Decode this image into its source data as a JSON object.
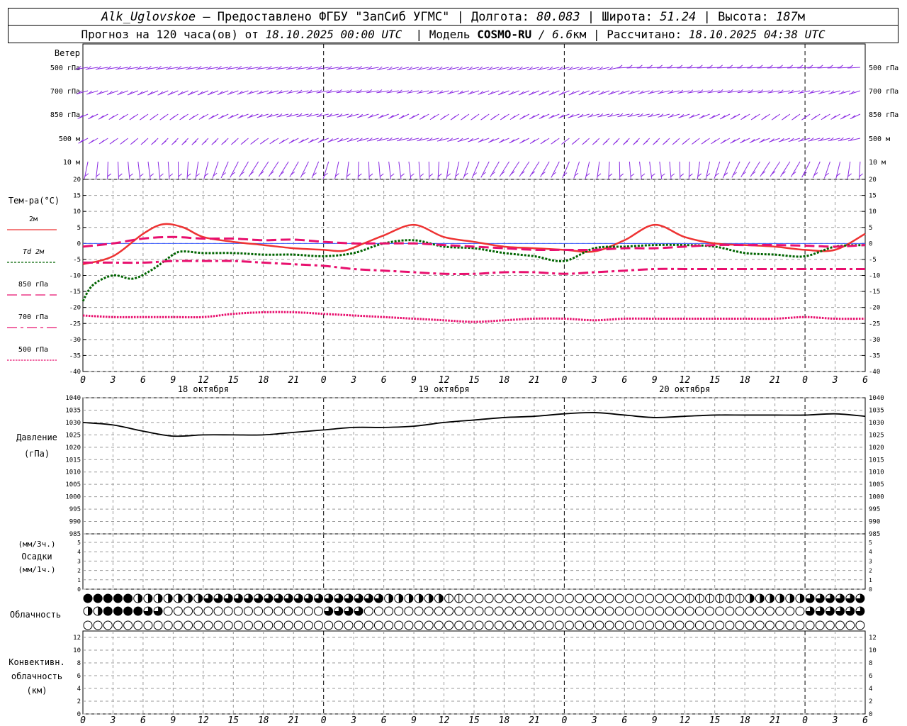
{
  "header": {
    "station": "Alk_Uglovskoe",
    "provider": "– Предоставлено ФГБУ \"ЗапСиб УГМС\"",
    "lon_label": "| Долгота:",
    "lon_value": "80.083",
    "lat_label": "| Широта:",
    "lat_value": "51.24",
    "alt_label": "| Высота:",
    "alt_value": "187",
    "alt_unit": "м",
    "forecast_label": "Прогноз на 120 часа(ов) от",
    "forecast_start": "18.10.2025 00:00 UTC",
    "model_label": "| Модель",
    "model_name": "COSMO-RU",
    "model_res_value": "/ 6.6",
    "model_res_unit": "км",
    "calc_label": "| Рассчитано:",
    "calc_time": "18.10.2025 04:38 UTC"
  },
  "colors": {
    "wind": "#8a2be2",
    "t2m": "#ee3333",
    "td2m": "#006400",
    "t850": "#e8106e",
    "t700": "#e8106e",
    "t500": "#e8106e",
    "pressure": "#000000",
    "grid": "#999999"
  },
  "chart_data": [
    {
      "type": "wind-barbs",
      "panel_label": "Ветер",
      "levels": [
        "500 гПа",
        "700 гПа",
        "850 гПа",
        "500 м",
        "10 м"
      ],
      "x_unit": "hours",
      "xlim": [
        0,
        78
      ]
    },
    {
      "type": "line",
      "panel_label": "Тем-ра(°C)",
      "ylim": [
        -40,
        20
      ],
      "yticks": [
        -40,
        -35,
        -30,
        -25,
        -20,
        -15,
        -10,
        -5,
        0,
        5,
        10,
        15,
        20
      ],
      "x_ticks": [
        "0",
        "3",
        "6",
        "9",
        "12",
        "15",
        "18",
        "21",
        "0",
        "3",
        "6",
        "9",
        "12",
        "15",
        "18",
        "21",
        "0",
        "3",
        "6",
        "9",
        "12",
        "15",
        "18",
        "21",
        "0",
        "3",
        "6"
      ],
      "dates": [
        "18 октября",
        "19 октября",
        "20 октября"
      ],
      "series": [
        {
          "name": "2м",
          "key": "t2m",
          "style": "solid",
          "x": [
            0,
            3,
            6,
            8,
            10,
            12,
            15,
            18,
            21,
            24,
            26,
            28,
            30,
            33,
            36,
            39,
            42,
            45,
            48,
            51,
            54,
            57,
            60,
            63,
            66,
            69,
            72,
            75,
            78
          ],
          "y": [
            -6.5,
            -4,
            3,
            6,
            5,
            2,
            0.5,
            -0.5,
            -1.5,
            -2,
            -2.3,
            0,
            2.5,
            5.8,
            2,
            0.5,
            -1,
            -1.5,
            -2,
            -2.5,
            1,
            5.8,
            2,
            0,
            -0.5,
            -1,
            -2,
            -2,
            3
          ]
        },
        {
          "name": "Td 2м",
          "key": "td2m",
          "style": "dotted",
          "x": [
            0,
            1,
            3,
            5,
            7,
            9,
            10,
            12,
            15,
            18,
            21,
            24,
            27,
            30,
            33,
            36,
            39,
            42,
            45,
            48,
            51,
            54,
            57,
            60,
            63,
            66,
            69,
            72,
            75,
            78
          ],
          "y": [
            -18,
            -13,
            -10,
            -11,
            -8,
            -3.5,
            -2.5,
            -3,
            -3,
            -3.5,
            -3.5,
            -4,
            -3,
            0,
            1,
            -1,
            -1.5,
            -3,
            -4,
            -5.5,
            -1.5,
            -1,
            -0.5,
            -0.5,
            -1,
            -3,
            -3.5,
            -4,
            -1,
            -0.5
          ]
        },
        {
          "name": "850 гПа",
          "key": "t850",
          "style": "dashed",
          "x": [
            0,
            3,
            6,
            9,
            12,
            15,
            18,
            21,
            24,
            27,
            30,
            33,
            36,
            39,
            42,
            45,
            48,
            51,
            54,
            57,
            60,
            63,
            66,
            69,
            72,
            75,
            78
          ],
          "y": [
            -1,
            0,
            1.5,
            2,
            1.5,
            1.5,
            1,
            1.2,
            0.5,
            0,
            0,
            0,
            -0.5,
            -1,
            -1.5,
            -2,
            -2,
            -2,
            -1.5,
            -1.5,
            -1,
            -0.5,
            -0.5,
            -0.5,
            -0.7,
            -1,
            -0.5
          ]
        },
        {
          "name": "700 гПа",
          "key": "t700",
          "style": "dashdot",
          "x": [
            0,
            3,
            6,
            9,
            12,
            15,
            18,
            21,
            24,
            27,
            30,
            33,
            36,
            39,
            42,
            45,
            48,
            51,
            54,
            57,
            60,
            63,
            66,
            69,
            72,
            75,
            78
          ],
          "y": [
            -6,
            -6,
            -6,
            -5.5,
            -5.5,
            -5.5,
            -6,
            -6.5,
            -7,
            -8,
            -8.5,
            -9,
            -9.5,
            -9.5,
            -9,
            -9,
            -9.5,
            -9,
            -8.5,
            -8,
            -8,
            -8,
            -8,
            -8,
            -8,
            -8,
            -8
          ]
        },
        {
          "name": "500 гПа",
          "key": "t500",
          "style": "densedot",
          "x": [
            0,
            3,
            6,
            9,
            12,
            15,
            18,
            21,
            24,
            27,
            30,
            33,
            36,
            39,
            42,
            45,
            48,
            51,
            54,
            57,
            60,
            63,
            66,
            69,
            72,
            75,
            78
          ],
          "y": [
            -22.5,
            -23,
            -23,
            -23,
            -23,
            -22,
            -21.5,
            -21.5,
            -22,
            -22.5,
            -23,
            -23.5,
            -24,
            -24.5,
            -24,
            -23.5,
            -23.5,
            -24,
            -23.5,
            -23.5,
            -23.5,
            -23.5,
            -23.5,
            -23.5,
            -23,
            -23.5,
            -23.5
          ]
        }
      ]
    },
    {
      "type": "line",
      "panel_label": "Давление",
      "unit_label": "(гПа)",
      "ylim": [
        985,
        1040
      ],
      "yticks": [
        985,
        990,
        995,
        1000,
        1005,
        1010,
        1015,
        1020,
        1025,
        1030,
        1035,
        1040
      ],
      "series": [
        {
          "key": "pressure",
          "x": [
            0,
            3,
            6,
            9,
            12,
            15,
            18,
            21,
            24,
            27,
            30,
            33,
            36,
            39,
            42,
            45,
            48,
            51,
            54,
            57,
            60,
            63,
            66,
            69,
            72,
            75,
            78
          ],
          "y": [
            1030,
            1029,
            1026.5,
            1024.5,
            1025,
            1025,
            1025,
            1026,
            1027,
            1028,
            1028,
            1028.5,
            1030,
            1031,
            1032,
            1032.5,
            1033.5,
            1034,
            1033,
            1032,
            1032.5,
            1033,
            1033,
            1033,
            1033,
            1033.5,
            1032.5
          ]
        }
      ]
    },
    {
      "type": "bar",
      "panel_label": "Осадки",
      "unit_top": "(мм/3ч.)",
      "unit_bottom": "(мм/1ч.)",
      "ylim": [
        0,
        5
      ],
      "yticks": [
        0,
        1,
        2,
        3,
        4,
        5
      ],
      "values": []
    },
    {
      "type": "cloud-symbols",
      "panel_label": "Облачность",
      "rows": 3,
      "levels": [
        "upper",
        "middle",
        "lower"
      ]
    },
    {
      "type": "bar",
      "panel_label_1": "Конвективн.",
      "panel_label_2": "облачность",
      "unit_label": "(км)",
      "ylim": [
        0,
        13
      ],
      "yticks": [
        0,
        2,
        4,
        6,
        8,
        10,
        12
      ],
      "values": []
    }
  ]
}
